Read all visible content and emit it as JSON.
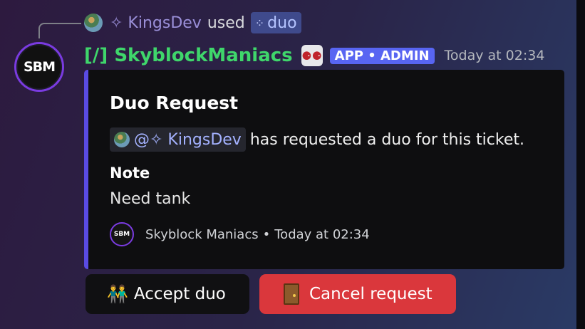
{
  "reply": {
    "username": "✧ KingsDev",
    "used_text": "used",
    "command_name": "duo",
    "command_icon": "⁘"
  },
  "message": {
    "avatar_text": "SBM",
    "author": "[/]  SkyblockManiacs",
    "author_emoji_text": "⚈⚈",
    "tag": "APP • ADMIN",
    "timestamp": "Today at 02:34",
    "author_color": "#3fd66b",
    "tag_color": "#5865f2"
  },
  "embed": {
    "title": "Duo Request",
    "mention": "@✧ KingsDev",
    "description": "has requested a duo for this ticket.",
    "field_name": "Note",
    "field_value": "Need tank",
    "footer_icon_text": "SBM",
    "footer_name": "Skyblock Maniacs",
    "footer_separator": "•",
    "footer_time": "Today at 02:34",
    "accent_color": "#5a4be3"
  },
  "buttons": {
    "accept": {
      "emoji": "👬",
      "label": "Accept duo"
    },
    "cancel": {
      "label": "Cancel request",
      "color": "#da373c"
    }
  }
}
